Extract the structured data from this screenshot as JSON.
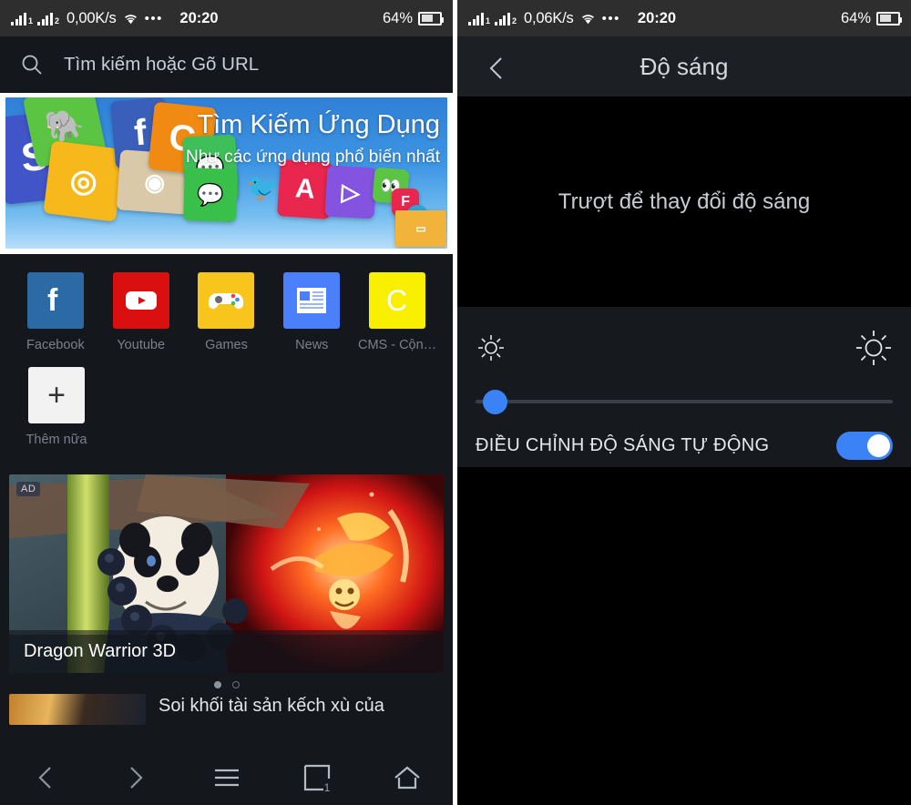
{
  "status_bar": {
    "signal_1_label": "1",
    "signal_2_label": "2",
    "network_speed_left": "0,00K/s",
    "network_speed_right": "0,06K/s",
    "wifi_icon": "wifi-icon",
    "overflow_icon": "more-dots-icon",
    "time": "20:20",
    "battery_percent": "64%",
    "battery_level": 64
  },
  "left_panel": {
    "name": "browser-home",
    "search": {
      "icon": "search-icon",
      "placeholder": "Tìm kiếm hoặc Gõ URL"
    },
    "hero_banner": {
      "title": "Tìm Kiếm Ứng Dụng",
      "subtitle": "Như các ứng dụng phổ biến nhất"
    },
    "shortcuts": [
      {
        "label": "Facebook",
        "icon": "facebook-icon",
        "color": "#2b6aa5",
        "glyph": "f"
      },
      {
        "label": "Youtube",
        "icon": "youtube-icon",
        "color": "#da0f0f",
        "glyph": "▶"
      },
      {
        "label": "Games",
        "icon": "gamepad-icon",
        "color": "#f8c51c",
        "glyph": "🎮"
      },
      {
        "label": "News",
        "icon": "news-icon",
        "color": "#4a80fb",
        "glyph": "▤"
      },
      {
        "label": "CMS - Cộn…",
        "icon": "cms-icon",
        "color": "#f8f000",
        "glyph": "C"
      }
    ],
    "add_more": {
      "label": "Thêm nữa",
      "icon": "plus-icon"
    },
    "ad_card": {
      "badge": "AD",
      "caption": "Dragon Warrior 3D"
    },
    "carousel": {
      "total": 2,
      "active_index": 0
    },
    "news_item": {
      "title": "Soi khối tài sản kếch xù của"
    },
    "navbar": [
      {
        "name": "nav-back",
        "icon": "chevron-left-icon"
      },
      {
        "name": "nav-forward",
        "icon": "chevron-right-icon"
      },
      {
        "name": "nav-menu",
        "icon": "hamburger-icon"
      },
      {
        "name": "nav-tabs",
        "icon": "tabs-icon",
        "badge": "1"
      },
      {
        "name": "nav-home",
        "icon": "home-icon"
      }
    ]
  },
  "right_panel": {
    "name": "brightness-settings",
    "back_icon": "chevron-left-icon",
    "title": "Độ sáng",
    "hint": "Trượt để thay đổi độ sáng",
    "brightness_low_icon": "sun-small-icon",
    "brightness_high_icon": "sun-large-icon",
    "slider": {
      "value": 2,
      "min": 0,
      "max": 100,
      "accent": "#3b82f6"
    },
    "auto_brightness": {
      "label": "ĐIỀU CHỈNH ĐỘ SÁNG TỰ ĐỘNG",
      "enabled": true,
      "accent": "#3b82f6"
    }
  }
}
